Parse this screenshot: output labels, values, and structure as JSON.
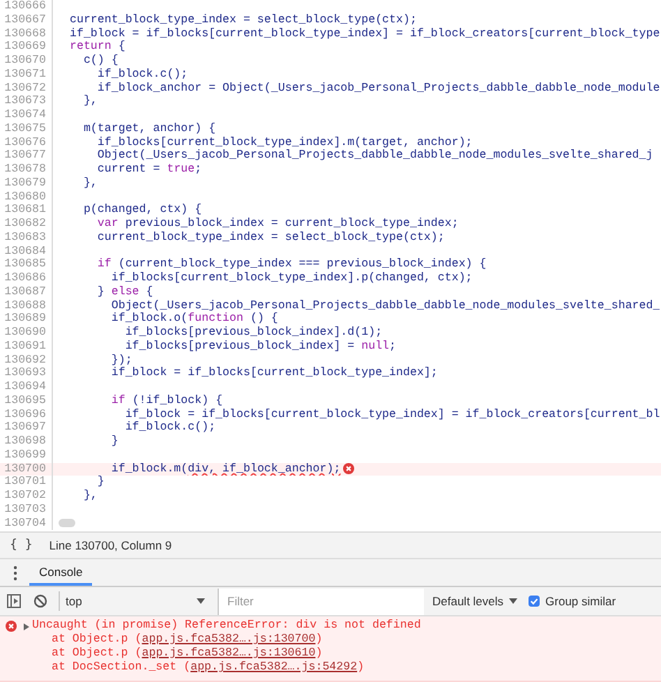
{
  "editor": {
    "lines": [
      {
        "number": "130666",
        "kind": "blank"
      },
      {
        "number": "130667",
        "kind": "code",
        "tokens": [
          {
            "text": "current_block_type_index = select_block_type(ctx);",
            "kind": "plain"
          }
        ]
      },
      {
        "number": "130668",
        "kind": "code",
        "tokens": [
          {
            "text": "if_block = if_blocks[current_block_type_index] = if_block_creators[current_block_type",
            "kind": "plain"
          }
        ]
      },
      {
        "number": "130669",
        "kind": "code",
        "tokens": [
          {
            "text": "return",
            "kind": "keyword"
          },
          {
            "text": " {",
            "kind": "plain"
          }
        ]
      },
      {
        "number": "130670",
        "kind": "code",
        "tokens": [
          {
            "text": "  c() {",
            "kind": "plain"
          }
        ]
      },
      {
        "number": "130671",
        "kind": "code",
        "tokens": [
          {
            "text": "    if_block.c();",
            "kind": "plain"
          }
        ]
      },
      {
        "number": "130672",
        "kind": "code",
        "tokens": [
          {
            "text": "    if_block_anchor = Object(_Users_jacob_Personal_Projects_dabble_dabble_node_module",
            "kind": "plain"
          }
        ]
      },
      {
        "number": "130673",
        "kind": "code",
        "tokens": [
          {
            "text": "  },",
            "kind": "plain"
          }
        ]
      },
      {
        "number": "130674",
        "kind": "blank"
      },
      {
        "number": "130675",
        "kind": "code",
        "tokens": [
          {
            "text": "  m(target, anchor) {",
            "kind": "plain"
          }
        ]
      },
      {
        "number": "130676",
        "kind": "code",
        "tokens": [
          {
            "text": "    if_blocks[current_block_type_index].m(target, anchor);",
            "kind": "plain"
          }
        ]
      },
      {
        "number": "130677",
        "kind": "code",
        "tokens": [
          {
            "text": "    Object(_Users_jacob_Personal_Projects_dabble_dabble_node_modules_svelte_shared_j",
            "kind": "plain"
          }
        ]
      },
      {
        "number": "130678",
        "kind": "code",
        "tokens": [
          {
            "text": "    current = ",
            "kind": "plain"
          },
          {
            "text": "true",
            "kind": "keyword"
          },
          {
            "text": ";",
            "kind": "plain"
          }
        ]
      },
      {
        "number": "130679",
        "kind": "code",
        "tokens": [
          {
            "text": "  },",
            "kind": "plain"
          }
        ]
      },
      {
        "number": "130680",
        "kind": "blank"
      },
      {
        "number": "130681",
        "kind": "code",
        "tokens": [
          {
            "text": "  p(changed, ctx) {",
            "kind": "plain"
          }
        ]
      },
      {
        "number": "130682",
        "kind": "code",
        "tokens": [
          {
            "text": "    var",
            "kind": "keyword"
          },
          {
            "text": " previous_block_index = current_block_type_index;",
            "kind": "plain"
          }
        ]
      },
      {
        "number": "130683",
        "kind": "code",
        "tokens": [
          {
            "text": "    current_block_type_index = select_block_type(ctx);",
            "kind": "plain"
          }
        ]
      },
      {
        "number": "130684",
        "kind": "blank"
      },
      {
        "number": "130685",
        "kind": "code",
        "tokens": [
          {
            "text": "    if",
            "kind": "keyword"
          },
          {
            "text": " (current_block_type_index === previous_block_index) {",
            "kind": "plain"
          }
        ]
      },
      {
        "number": "130686",
        "kind": "code",
        "tokens": [
          {
            "text": "      if_blocks[current_block_type_index].p(changed, ctx);",
            "kind": "plain"
          }
        ]
      },
      {
        "number": "130687",
        "kind": "code",
        "tokens": [
          {
            "text": "    } ",
            "kind": "plain"
          },
          {
            "text": "else",
            "kind": "keyword"
          },
          {
            "text": " {",
            "kind": "plain"
          }
        ]
      },
      {
        "number": "130688",
        "kind": "code",
        "tokens": [
          {
            "text": "      Object(_Users_jacob_Personal_Projects_dabble_dabble_node_modules_svelte_shared_",
            "kind": "plain"
          }
        ]
      },
      {
        "number": "130689",
        "kind": "code",
        "tokens": [
          {
            "text": "      if_block.o(",
            "kind": "plain"
          },
          {
            "text": "function",
            "kind": "keyword"
          },
          {
            "text": " () {",
            "kind": "plain"
          }
        ]
      },
      {
        "number": "130690",
        "kind": "code",
        "tokens": [
          {
            "text": "        if_blocks[previous_block_index].d(1);",
            "kind": "plain"
          }
        ]
      },
      {
        "number": "130691",
        "kind": "code",
        "tokens": [
          {
            "text": "        if_blocks[previous_block_index] = ",
            "kind": "plain"
          },
          {
            "text": "null",
            "kind": "keyword"
          },
          {
            "text": ";",
            "kind": "plain"
          }
        ]
      },
      {
        "number": "130692",
        "kind": "code",
        "tokens": [
          {
            "text": "      });",
            "kind": "plain"
          }
        ]
      },
      {
        "number": "130693",
        "kind": "code",
        "tokens": [
          {
            "text": "      if_block = if_blocks[current_block_type_index];",
            "kind": "plain"
          }
        ]
      },
      {
        "number": "130694",
        "kind": "blank"
      },
      {
        "number": "130695",
        "kind": "code",
        "tokens": [
          {
            "text": "      if",
            "kind": "keyword"
          },
          {
            "text": " (!if_block) {",
            "kind": "plain"
          }
        ]
      },
      {
        "number": "130696",
        "kind": "code",
        "tokens": [
          {
            "text": "        if_block = if_blocks[current_block_type_index] = if_block_creators[current_bl",
            "kind": "plain"
          }
        ]
      },
      {
        "number": "130697",
        "kind": "code",
        "tokens": [
          {
            "text": "        if_block.c();",
            "kind": "plain"
          }
        ]
      },
      {
        "number": "130698",
        "kind": "code",
        "tokens": [
          {
            "text": "      }",
            "kind": "plain"
          }
        ]
      },
      {
        "number": "130699",
        "kind": "blank"
      },
      {
        "number": "130700",
        "kind": "error",
        "tokens": [
          {
            "text": "      if_block.m(",
            "kind": "plain"
          },
          {
            "text": "div, if_block_anchor);",
            "kind": "squiggle"
          }
        ]
      },
      {
        "number": "130701",
        "kind": "code",
        "tokens": [
          {
            "text": "    }",
            "kind": "plain"
          }
        ]
      },
      {
        "number": "130702",
        "kind": "code",
        "tokens": [
          {
            "text": "  },",
            "kind": "plain"
          }
        ]
      },
      {
        "number": "130703",
        "kind": "blank"
      },
      {
        "number": "130704",
        "kind": "blank"
      }
    ]
  },
  "status_bar": {
    "pretty_print": "{ }",
    "cursor_position": "Line 130700, Column 9"
  },
  "drawer": {
    "tabs": [
      {
        "label": "Console",
        "selected": true
      }
    ]
  },
  "console_toolbar": {
    "context": "top",
    "filter": {
      "placeholder": "Filter"
    },
    "levels": "Default levels",
    "group_similar": {
      "label": "Group similar",
      "checked": true
    }
  },
  "messages": [
    {
      "kind": "error",
      "text": "Uncaught (in promise) ReferenceError: div is not defined",
      "stack": [
        {
          "prefix": "at Object.p (",
          "link": "app.js.fca5382….js:130700",
          "suffix": ")"
        },
        {
          "prefix": "at Object.p (",
          "link": "app.js.fca5382….js:130610",
          "suffix": ")"
        },
        {
          "prefix": "at DocSection._set (",
          "link": "app.js.fca5382….js:54292",
          "suffix": ")"
        }
      ]
    }
  ]
}
